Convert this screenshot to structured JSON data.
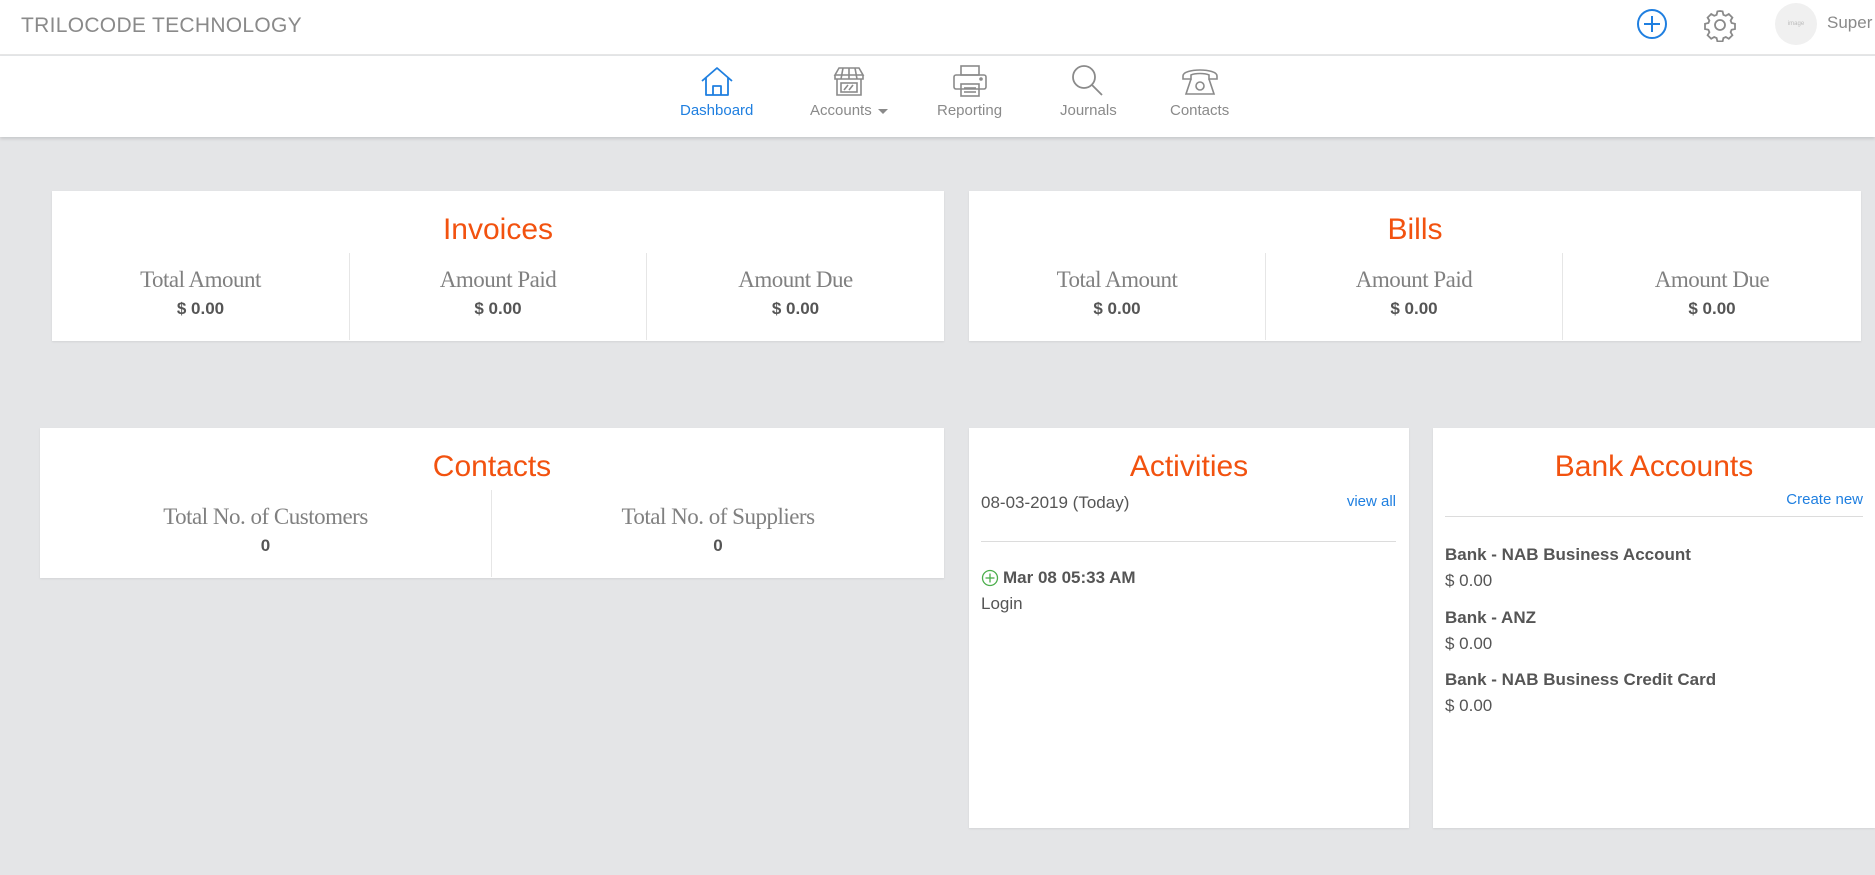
{
  "header": {
    "brand": "TRILOCODE TECHNOLOGY",
    "avatar_text": "image",
    "user_name": "Super"
  },
  "nav": {
    "items": [
      {
        "label": "Dashboard",
        "icon": "home-icon",
        "active": true
      },
      {
        "label": "Accounts",
        "icon": "store-icon",
        "dropdown": true
      },
      {
        "label": "Reporting",
        "icon": "printer-icon"
      },
      {
        "label": "Journals",
        "icon": "search-icon"
      },
      {
        "label": "Contacts",
        "icon": "telephone-icon"
      }
    ]
  },
  "invoices": {
    "title": "Invoices",
    "stats": [
      {
        "label": "Total Amount",
        "value": "$ 0.00"
      },
      {
        "label": "Amount Paid",
        "value": "$ 0.00"
      },
      {
        "label": "Amount Due",
        "value": "$ 0.00"
      }
    ]
  },
  "bills": {
    "title": "Bills",
    "stats": [
      {
        "label": "Total Amount",
        "value": "$ 0.00"
      },
      {
        "label": "Amount Paid",
        "value": "$ 0.00"
      },
      {
        "label": "Amount Due",
        "value": "$ 0.00"
      }
    ]
  },
  "contacts": {
    "title": "Contacts",
    "stats": [
      {
        "label": "Total No. of Customers",
        "value": "0"
      },
      {
        "label": "Total No. of Suppliers",
        "value": "0"
      }
    ]
  },
  "activities": {
    "title": "Activities",
    "date": "08-03-2019 (Today)",
    "view_all": "view all",
    "items": [
      {
        "time": "Mar 08 05:33 AM",
        "text": "Login"
      }
    ]
  },
  "bank_accounts": {
    "title": "Bank Accounts",
    "create_new": "Create new",
    "items": [
      {
        "name": "Bank - NAB Business Account",
        "amount": "$ 0.00"
      },
      {
        "name": "Bank - ANZ",
        "amount": "$ 0.00"
      },
      {
        "name": "Bank - NAB Business Credit Card",
        "amount": "$ 0.00"
      }
    ]
  },
  "colors": {
    "accent": "#f2520f",
    "link": "#1f7fe0",
    "background": "#e4e5e7"
  }
}
